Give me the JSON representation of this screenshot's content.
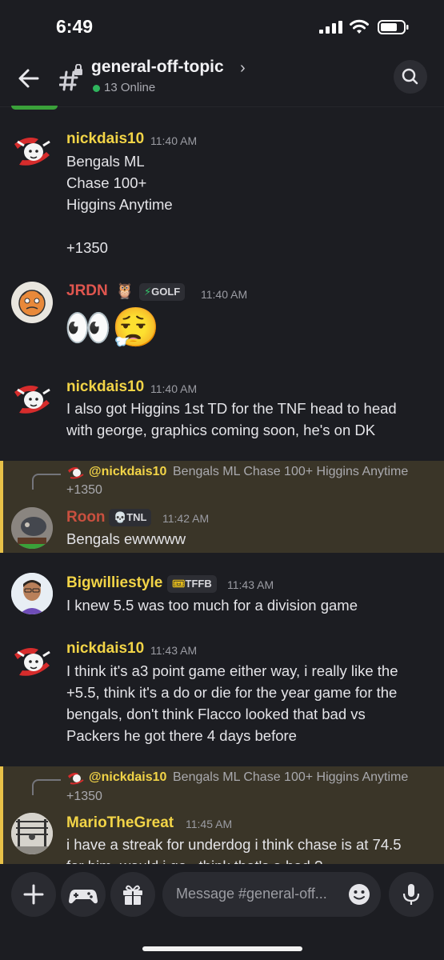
{
  "status_bar": {
    "time": "6:49"
  },
  "header": {
    "channel_name": "general-off-topic",
    "chevron": "›",
    "online": "13 Online"
  },
  "messages": [
    {
      "user": "nickdais10",
      "time": "11:40 AM",
      "lines": [
        "Bengals ML",
        "Chase 100+",
        "Higgins Anytime",
        "",
        "+1350"
      ]
    },
    {
      "user": "JRDN",
      "tag": "GOLF",
      "time": "11:40 AM",
      "emoji": "👀😮‍💨"
    },
    {
      "user": "nickdais10",
      "time": "11:40 AM",
      "lines": [
        "I also got Higgins 1st TD for the TNF head to head",
        "with george, graphics coming soon, he's on DK"
      ]
    },
    {
      "reply_user": "@nickdais10",
      "reply_line1": "Bengals ML  Chase 100+ Higgins Anytime",
      "reply_line2": "+1350",
      "user": "Roon",
      "tag": "TNL",
      "time": "11:42 AM",
      "lines": [
        "Bengals ewwwww"
      ]
    },
    {
      "user": "Bigwilliestyle",
      "tag": "TFFB",
      "time": "11:43 AM",
      "lines": [
        "I knew 5.5 was too much for a division game"
      ]
    },
    {
      "user": "nickdais10",
      "time": "11:43 AM",
      "lines": [
        "I think it's  a3 point game either way, i really like the",
        "+5.5, think it's a do or die for the year game for the",
        "bengals, don't think Flacco looked that bad vs",
        "Packers he got there 4 days before"
      ]
    },
    {
      "reply_user": "@nickdais10",
      "reply_line1": "Bengals ML  Chase 100+ Higgins Anytime",
      "reply_line2": "+1350",
      "user": "MarioTheGreat",
      "time": "11:45 AM",
      "lines": [
        "i have a streak for underdog i think chase is at 74.5",
        "for him, would i go , think that's a bad ?"
      ]
    }
  ],
  "input": {
    "placeholder": "Message #general-off..."
  },
  "colors": {
    "yellow_name": "#f2d447",
    "red_name": "#e0564f",
    "roon_name": "#c9503f",
    "reply_bg": "#3a3528",
    "reply_bar": "#e8c148"
  },
  "icons": [
    "back-arrow-icon",
    "channel-hash-lock-icon",
    "search-icon",
    "plus-icon",
    "gamepad-icon",
    "gift-icon",
    "emoji-icon",
    "microphone-icon"
  ]
}
